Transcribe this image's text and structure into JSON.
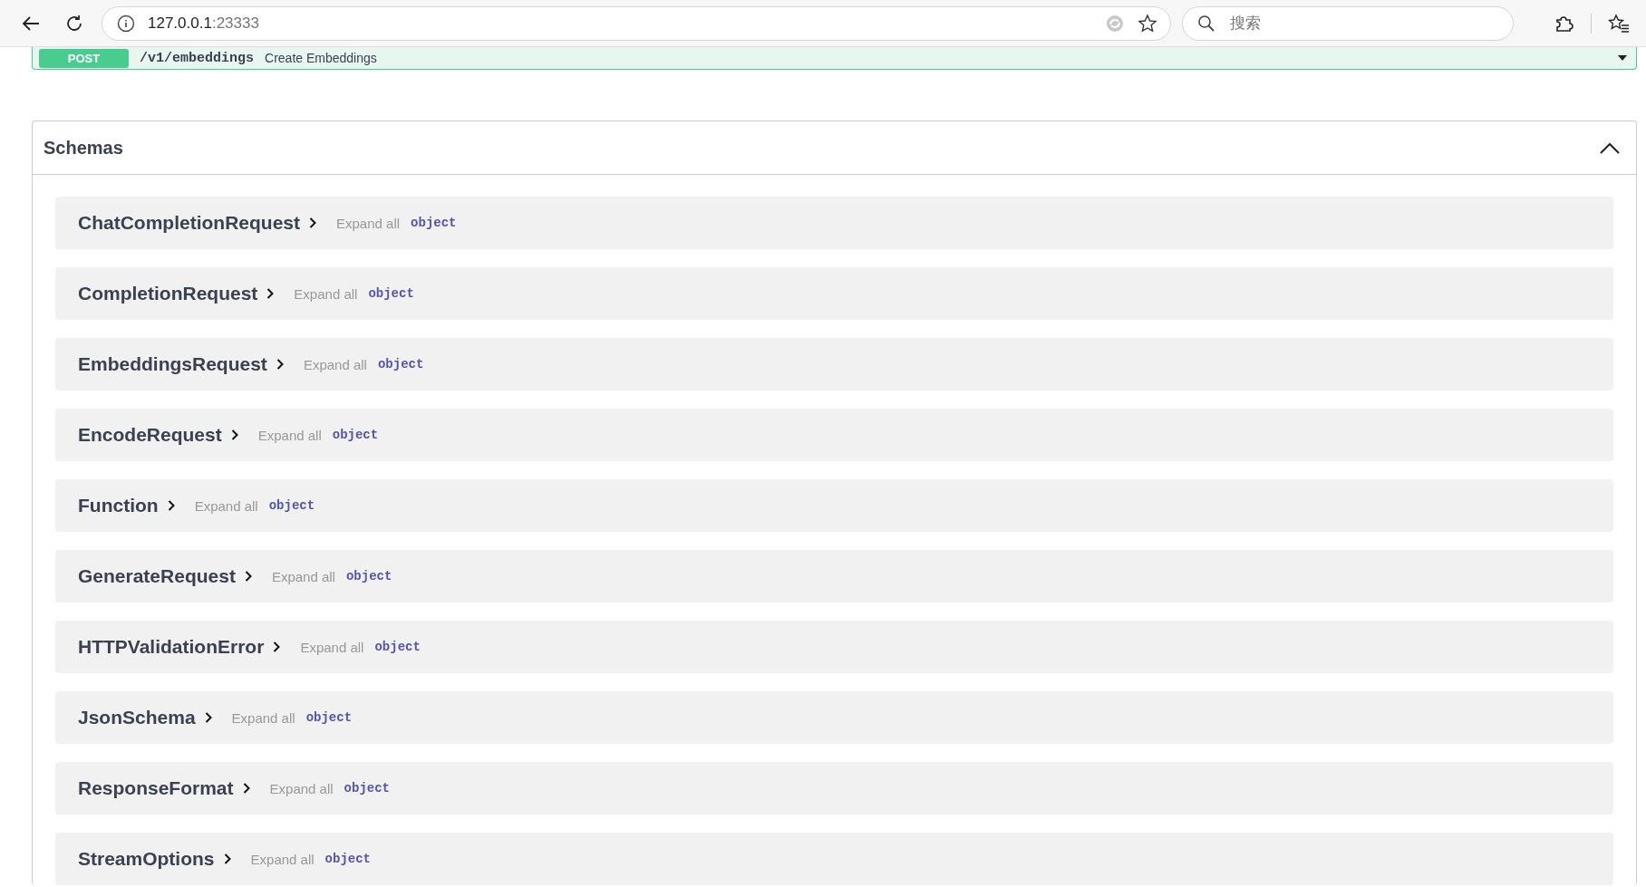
{
  "browser": {
    "url_host": "127.0.0.1",
    "url_port": ":23333",
    "search_placeholder": "搜索"
  },
  "operation": {
    "method": "POST",
    "path": "/v1/embeddings",
    "summary": "Create Embeddings"
  },
  "schemas": {
    "title": "Schemas",
    "expanded": true,
    "items": [
      {
        "name": "ChatCompletionRequest",
        "expand_label": "Expand all",
        "type": "object"
      },
      {
        "name": "CompletionRequest",
        "expand_label": "Expand all",
        "type": "object"
      },
      {
        "name": "EmbeddingsRequest",
        "expand_label": "Expand all",
        "type": "object"
      },
      {
        "name": "EncodeRequest",
        "expand_label": "Expand all",
        "type": "object"
      },
      {
        "name": "Function",
        "expand_label": "Expand all",
        "type": "object"
      },
      {
        "name": "GenerateRequest",
        "expand_label": "Expand all",
        "type": "object"
      },
      {
        "name": "HTTPValidationError",
        "expand_label": "Expand all",
        "type": "object"
      },
      {
        "name": "JsonSchema",
        "expand_label": "Expand all",
        "type": "object"
      },
      {
        "name": "ResponseFormat",
        "expand_label": "Expand all",
        "type": "object"
      },
      {
        "name": "StreamOptions",
        "expand_label": "Expand all",
        "type": "object"
      }
    ]
  }
}
